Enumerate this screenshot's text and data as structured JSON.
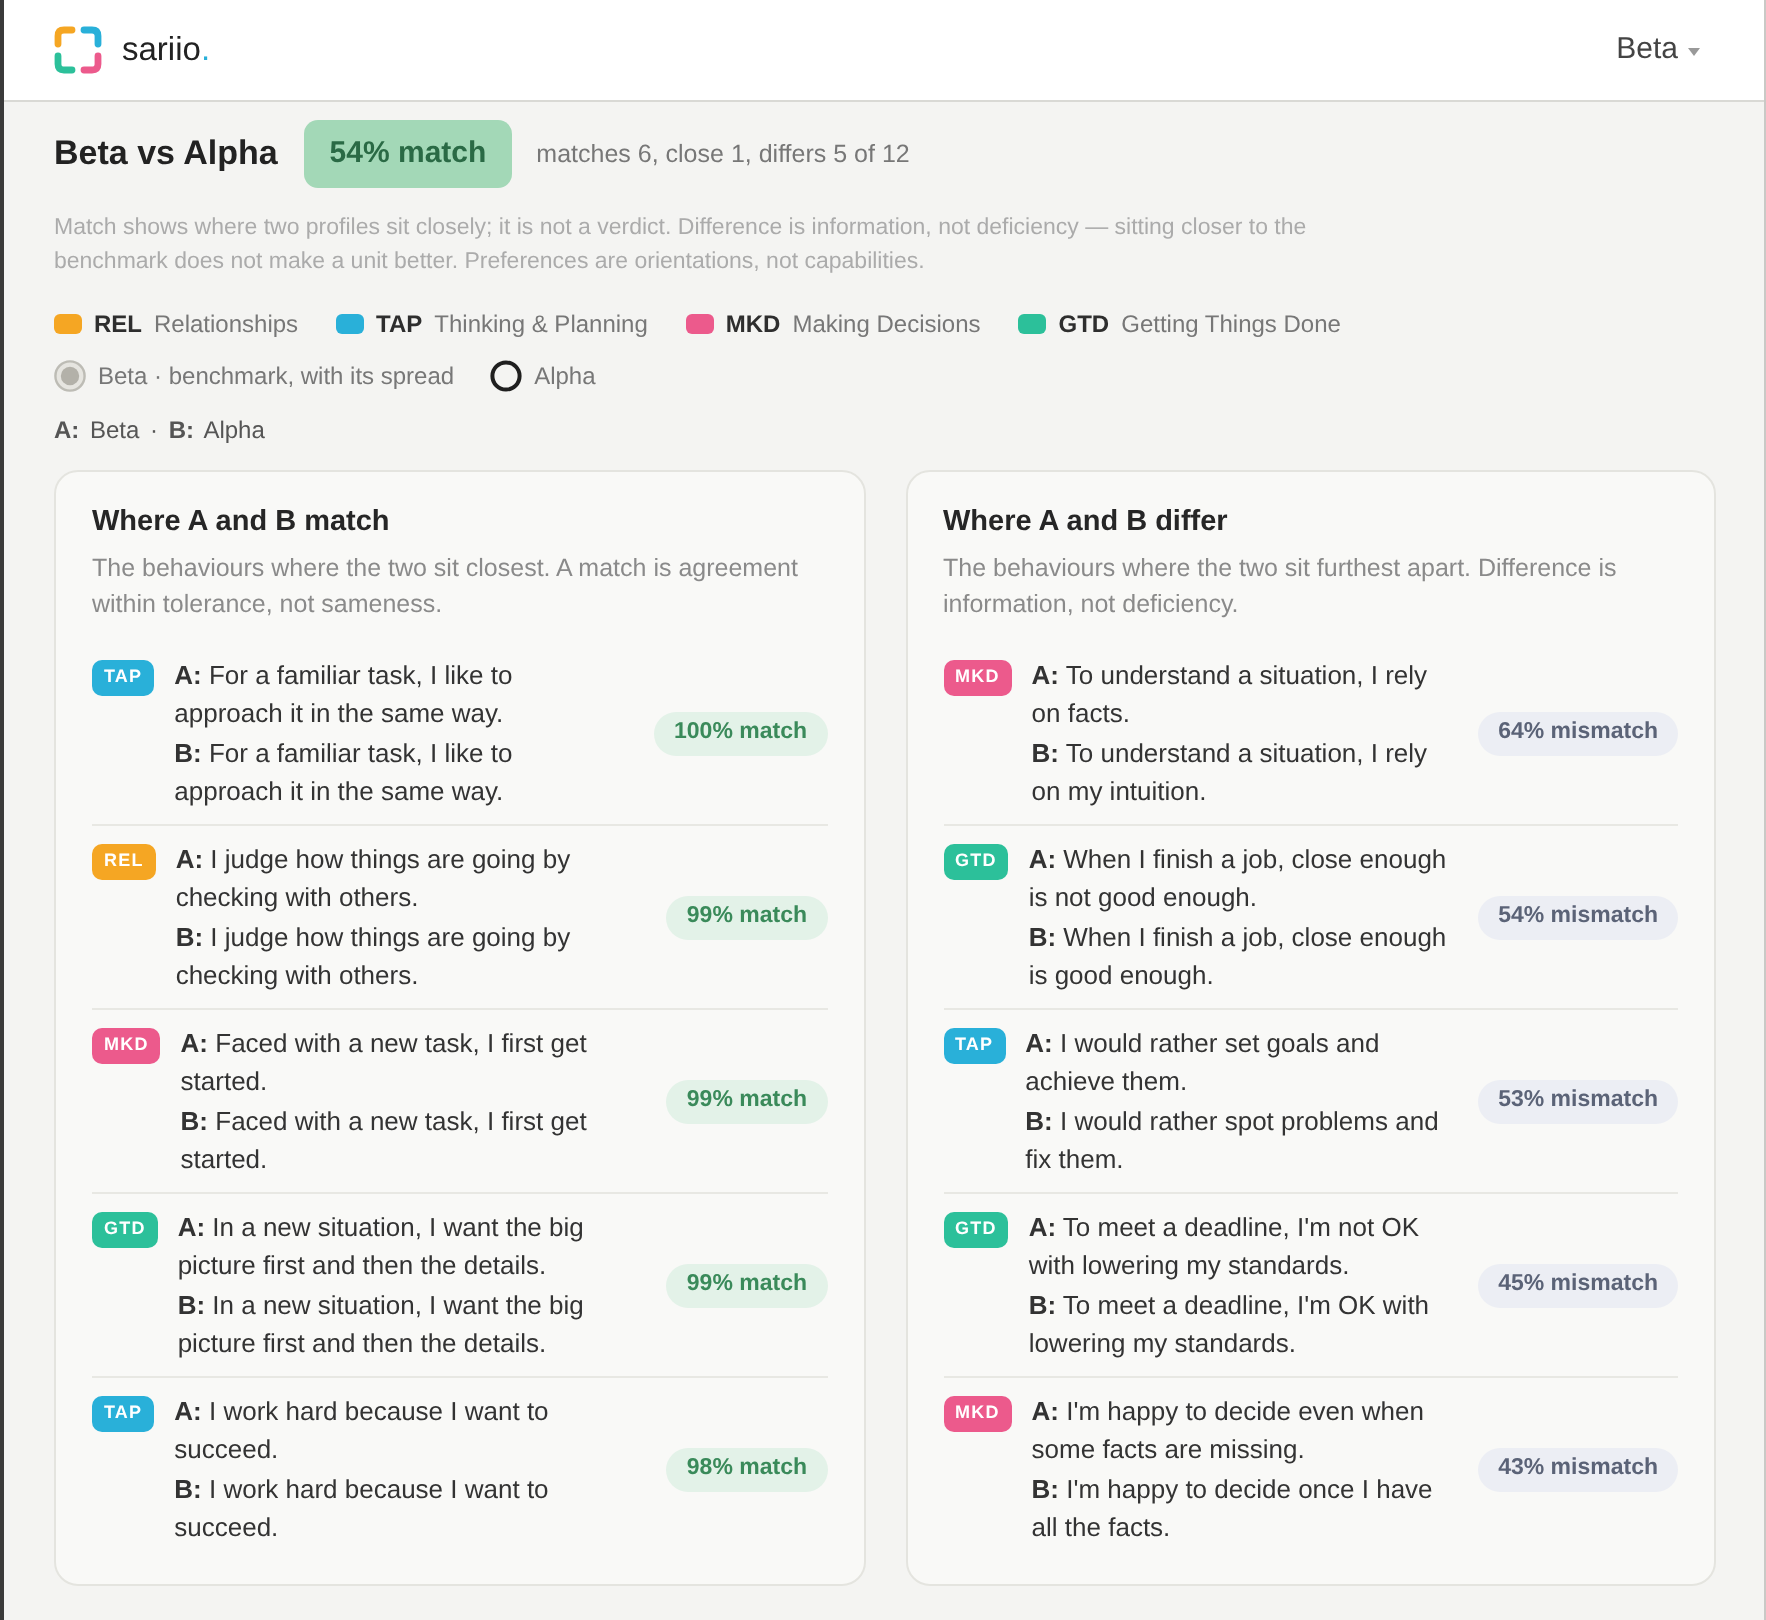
{
  "header": {
    "brand": {
      "name": "sariio",
      "dot": "."
    },
    "profile_menu": {
      "label": "Beta"
    }
  },
  "summary": {
    "title": "Beta vs Alpha",
    "badge": "54% match",
    "counts": "matches 6, close 1, differs 5 of 12"
  },
  "disclaimer": "Match shows where two profiles sit closely; it is not a verdict. Difference is information, not deficiency — sitting closer to the benchmark does not make a unit better. Preferences are orientations, not capabilities.",
  "categories": [
    {
      "code": "REL",
      "name": "Relationships",
      "color": "#f5a623"
    },
    {
      "code": "TAP",
      "name": "Thinking & Planning",
      "color": "#29b0d9"
    },
    {
      "code": "MKD",
      "name": "Making Decisions",
      "color": "#ec5a8c"
    },
    {
      "code": "GTD",
      "name": "Getting Things Done",
      "color": "#2cc09a"
    }
  ],
  "markers": [
    {
      "kind": "benchmark",
      "label": "Beta · benchmark, with its spread"
    },
    {
      "kind": "profile",
      "label": "Alpha"
    }
  ],
  "key": "**A:** Beta · **B:** Alpha",
  "panels": [
    {
      "kind": "match",
      "title": "Where A and B match",
      "description": "The behaviours where the two sit closest. A match is agreement within tolerance, not sameness.",
      "rows": [
        {
          "tag": "TAP",
          "color": "#29b0d9",
          "a": "**A:** For a familiar task, I like to approach it in the same way.",
          "b": "**B:** For a familiar task, I like to approach it in the same way.",
          "score": "100% match"
        },
        {
          "tag": "REL",
          "color": "#f5a623",
          "a": "**A:** I judge how things are going by checking with others.",
          "b": "**B:** I judge how things are going by checking with others.",
          "score": "99% match"
        },
        {
          "tag": "MKD",
          "color": "#ec5a8c",
          "a": "**A:** Faced with a new task, I first get started.",
          "b": "**B:** Faced with a new task, I first get started.",
          "score": "99% match"
        },
        {
          "tag": "GTD",
          "color": "#2cc09a",
          "a": "**A:** In a new situation, I want the big picture first and then the details.",
          "b": "**B:** In a new situation, I want the big picture first and then the details.",
          "score": "99% match"
        },
        {
          "tag": "TAP",
          "color": "#29b0d9",
          "a": "**A:** I work hard because I want to succeed.",
          "b": "**B:** I work hard because I want to succeed.",
          "score": "98% match"
        }
      ]
    },
    {
      "kind": "differ",
      "title": "Where A and B differ",
      "description": "The behaviours where the two sit furthest apart. Difference is information, not deficiency.",
      "rows": [
        {
          "tag": "MKD",
          "color": "#ec5a8c",
          "a": "**A:** To understand a situation, I rely on facts.",
          "b": "**B:** To understand a situation, I rely on my intuition.",
          "score": "64% mismatch"
        },
        {
          "tag": "GTD",
          "color": "#2cc09a",
          "a": "**A:** When I finish a job, close enough is not good enough.",
          "b": "**B:** When I finish a job, close enough is good enough.",
          "score": "54% mismatch"
        },
        {
          "tag": "TAP",
          "color": "#29b0d9",
          "a": "**A:** I would rather set goals and achieve them.",
          "b": "**B:** I would rather spot problems and fix them.",
          "score": "53% mismatch"
        },
        {
          "tag": "GTD",
          "color": "#2cc09a",
          "a": "**A:** To meet a deadline, I'm not OK with lowering my standards.",
          "b": "**B:** To meet a deadline, I'm OK with lowering my standards.",
          "score": "45% mismatch"
        },
        {
          "tag": "MKD",
          "color": "#ec5a8c",
          "a": "**A:** I'm happy to decide even when some facts are missing.",
          "b": "**B:** I'm happy to decide once I have all the facts.",
          "score": "43% mismatch"
        }
      ]
    }
  ]
}
